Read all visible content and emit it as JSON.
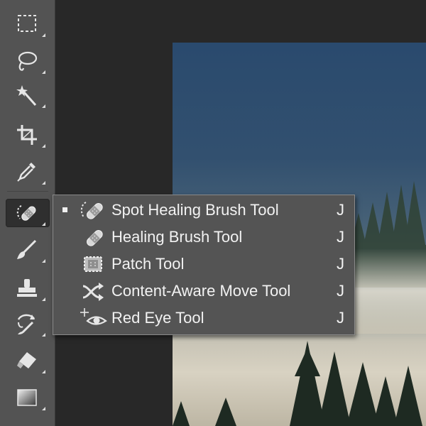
{
  "colors": {
    "toolbar_bg": "#535353",
    "workspace_bg": "#282828",
    "flyout_bg": "#545454",
    "text": "#f2f2f2"
  },
  "toolbar": {
    "tools": [
      {
        "name": "rectangular-marquee-icon"
      },
      {
        "name": "lasso-icon"
      },
      {
        "name": "magic-wand-icon"
      },
      {
        "name": "crop-icon"
      },
      {
        "name": "eyedropper-icon"
      },
      {
        "name": "spot-healing-brush-icon",
        "active": true
      },
      {
        "name": "brush-icon"
      },
      {
        "name": "clone-stamp-icon"
      },
      {
        "name": "history-brush-icon"
      },
      {
        "name": "eraser-icon"
      },
      {
        "name": "gradient-icon"
      }
    ]
  },
  "flyout": {
    "items": [
      {
        "label": "Spot Healing Brush Tool",
        "shortcut": "J",
        "selected": true,
        "icon": "spot-healing-brush-icon"
      },
      {
        "label": "Healing Brush Tool",
        "shortcut": "J",
        "selected": false,
        "icon": "healing-brush-icon"
      },
      {
        "label": "Patch Tool",
        "shortcut": "J",
        "selected": false,
        "icon": "patch-icon"
      },
      {
        "label": "Content-Aware Move Tool",
        "shortcut": "J",
        "selected": false,
        "icon": "content-aware-move-icon"
      },
      {
        "label": "Red Eye Tool",
        "shortcut": "J",
        "selected": false,
        "icon": "red-eye-icon"
      }
    ]
  }
}
